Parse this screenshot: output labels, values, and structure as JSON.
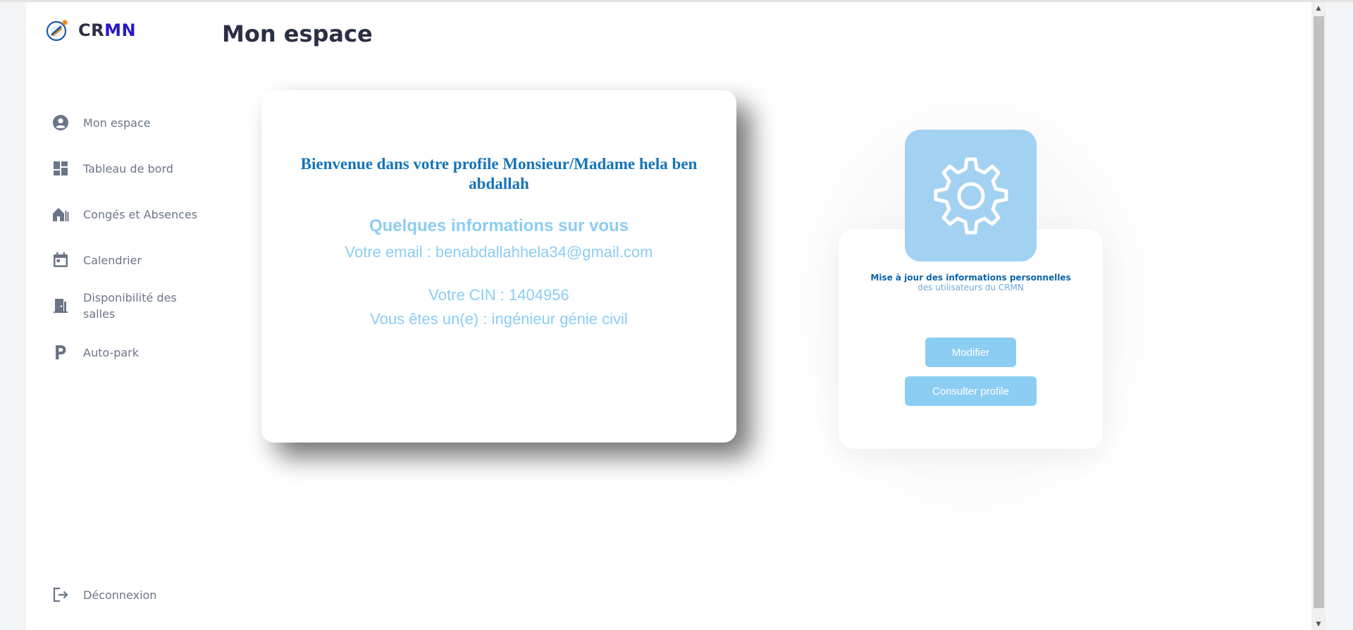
{
  "brand": {
    "part1": "CR",
    "part2": "MN"
  },
  "page": {
    "title": "Mon espace"
  },
  "sidebar": {
    "items": [
      {
        "label": "Mon espace",
        "icon": "user-circle-icon"
      },
      {
        "label": "Tableau de bord",
        "icon": "dashboard-grid-icon"
      },
      {
        "label": "Congés et Absences",
        "icon": "house-icon"
      },
      {
        "label": "Calendrier",
        "icon": "calendar-icon"
      },
      {
        "label": "Disponibilité des salles",
        "icon": "door-icon"
      },
      {
        "label": "Auto-park",
        "icon": "parking-icon"
      }
    ],
    "logout": {
      "label": "Déconnexion",
      "icon": "logout-icon"
    }
  },
  "welcome": {
    "title": "Bienvenue dans votre profile Monsieur/Madame hela ben abdallah",
    "info_heading": "Quelques informations sur vous",
    "email_line": "Votre email : benabdallahhela34@gmail.com",
    "cin_line": "Votre CIN : 1404956",
    "role_line": "Vous êtes un(e) : ingénieur génie civil"
  },
  "settings": {
    "icon": "gear-icon",
    "title": "Mise à jour des informations personnelles",
    "subtitle": "des utilisateurs du CRMN",
    "modify_label": "Modifier",
    "profile_label": "Consulter profile"
  },
  "colors": {
    "title": "#2b2f45",
    "brand_blue": "#2a18c8",
    "welcome_blue": "#1574b8",
    "light_blue": "#8ccdf3",
    "tile_blue": "#a2d1f2",
    "nav_gray": "#6b7588"
  }
}
